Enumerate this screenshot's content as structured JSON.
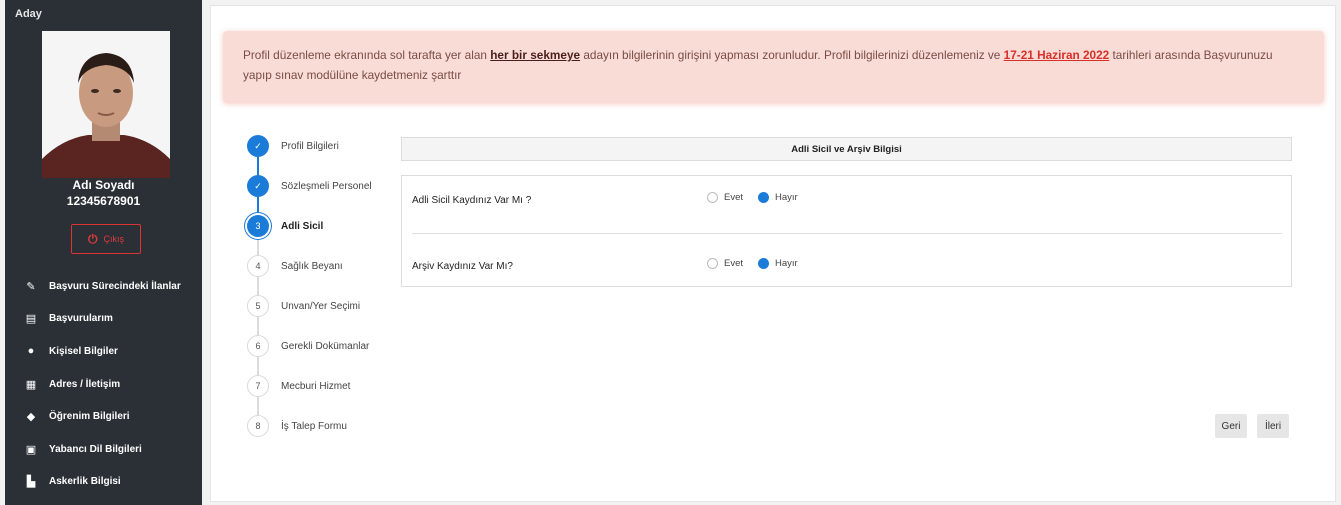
{
  "sidebar": {
    "role": "Aday",
    "user_name": "Adı Soyadı",
    "user_id": "12345678901",
    "logout_label": "Çıkış",
    "menu": [
      {
        "label": "Başvuru Sürecindeki İlanlar",
        "icon": "edit-icon"
      },
      {
        "label": "Başvurularım",
        "icon": "document-icon"
      },
      {
        "label": "Kişisel Bilgiler",
        "icon": "user-icon"
      },
      {
        "label": "Adres / İletişim",
        "icon": "address-card-icon"
      },
      {
        "label": "Öğrenim Bilgileri",
        "icon": "graduation-cap-icon"
      },
      {
        "label": "Yabancı Dil Bilgileri",
        "icon": "book-icon"
      },
      {
        "label": "Askerlik Bilgisi",
        "icon": "military-icon"
      }
    ]
  },
  "alert": {
    "part1": "Profil düzenleme ekranında sol tarafta yer alan ",
    "emph1": "her bir sekmeye",
    "part2": " adayın bilgilerinin girişini yapması zorunludur.  Profil bilgilerinizi düzenlemeniz ve ",
    "emph2": "17-21 Haziran 2022",
    "part3": " tarihleri arasında Başvurunuzu yapıp sınav modülüne kaydetmeniz şarttır"
  },
  "steps": [
    {
      "num": "",
      "label": "Profil Bilgileri",
      "state": "done"
    },
    {
      "num": "",
      "label": "Sözleşmeli Personel",
      "state": "done"
    },
    {
      "num": "3",
      "label": "Adli Sicil",
      "state": "active"
    },
    {
      "num": "4",
      "label": "Sağlık Beyanı",
      "state": "todo"
    },
    {
      "num": "5",
      "label": "Unvan/Yer Seçimi",
      "state": "todo"
    },
    {
      "num": "6",
      "label": "Gerekli Dokümanlar",
      "state": "todo"
    },
    {
      "num": "7",
      "label": "Mecburi Hizmet",
      "state": "todo"
    },
    {
      "num": "8",
      "label": "İş Talep Formu",
      "state": "todo"
    }
  ],
  "panel": {
    "title": "Adli Sicil ve Arşiv Bilgisi",
    "questions": [
      {
        "label": "Adli Sicil Kaydınız Var Mı ?",
        "yes": "Evet",
        "no": "Hayır",
        "selected": "Hayır"
      },
      {
        "label": "Arşiv Kaydınız Var Mı?",
        "yes": "Evet",
        "no": "Hayır",
        "selected": "Hayır"
      }
    ]
  },
  "buttons": {
    "back": "Geri",
    "next": "İleri"
  },
  "colors": {
    "sidebar_bg": "#2a3036",
    "accent": "#1b7bd8",
    "alert_bg": "#f9dcd6",
    "danger": "#d9302a"
  }
}
